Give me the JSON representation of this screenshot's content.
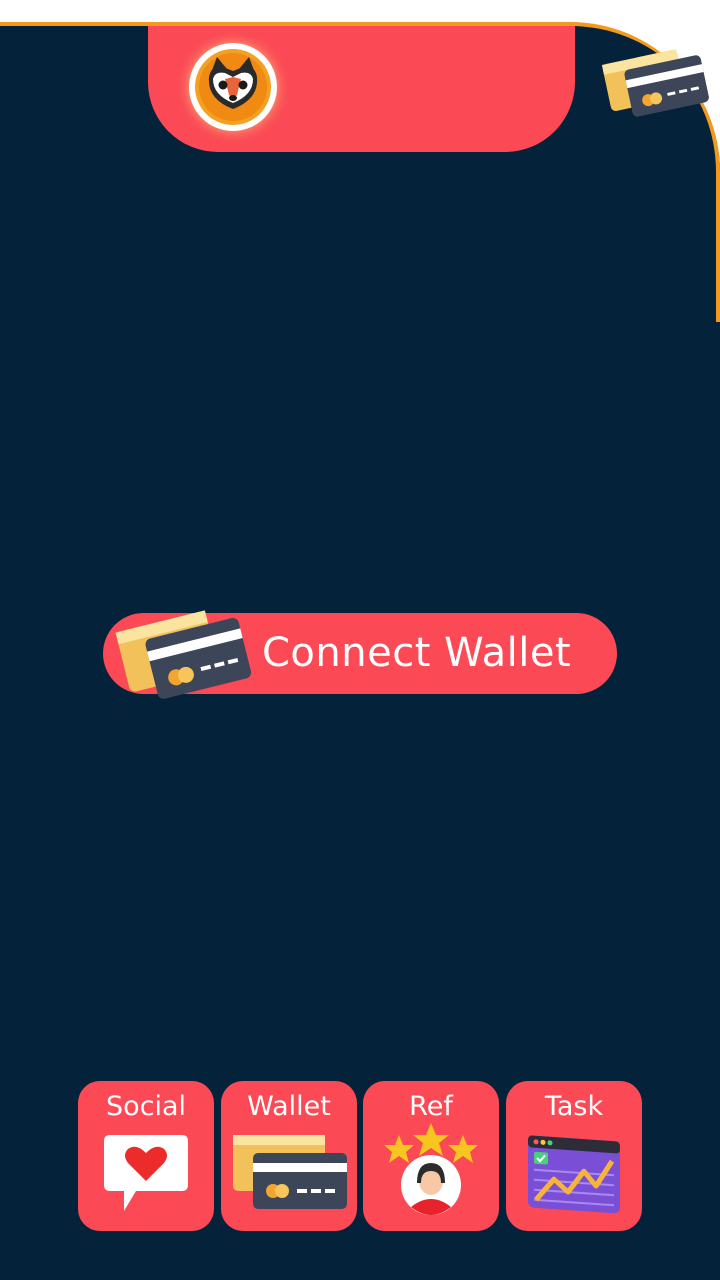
{
  "header": {
    "avatar_icon": "fox-icon",
    "corner_icon": "credit-card-icon"
  },
  "main": {
    "connect_button": {
      "label": "Connect Wallet",
      "icon": "credit-card-icon"
    }
  },
  "bottom_nav": {
    "items": [
      {
        "label": "Social",
        "icon": "heart-chat-icon"
      },
      {
        "label": "Wallet",
        "icon": "credit-card-icon"
      },
      {
        "label": "Ref",
        "icon": "referral-stars-icon"
      },
      {
        "label": "Task",
        "icon": "chart-window-icon"
      }
    ]
  },
  "colors": {
    "background": "#05223b",
    "accent": "#fb4a56",
    "border": "#f39a1e"
  }
}
